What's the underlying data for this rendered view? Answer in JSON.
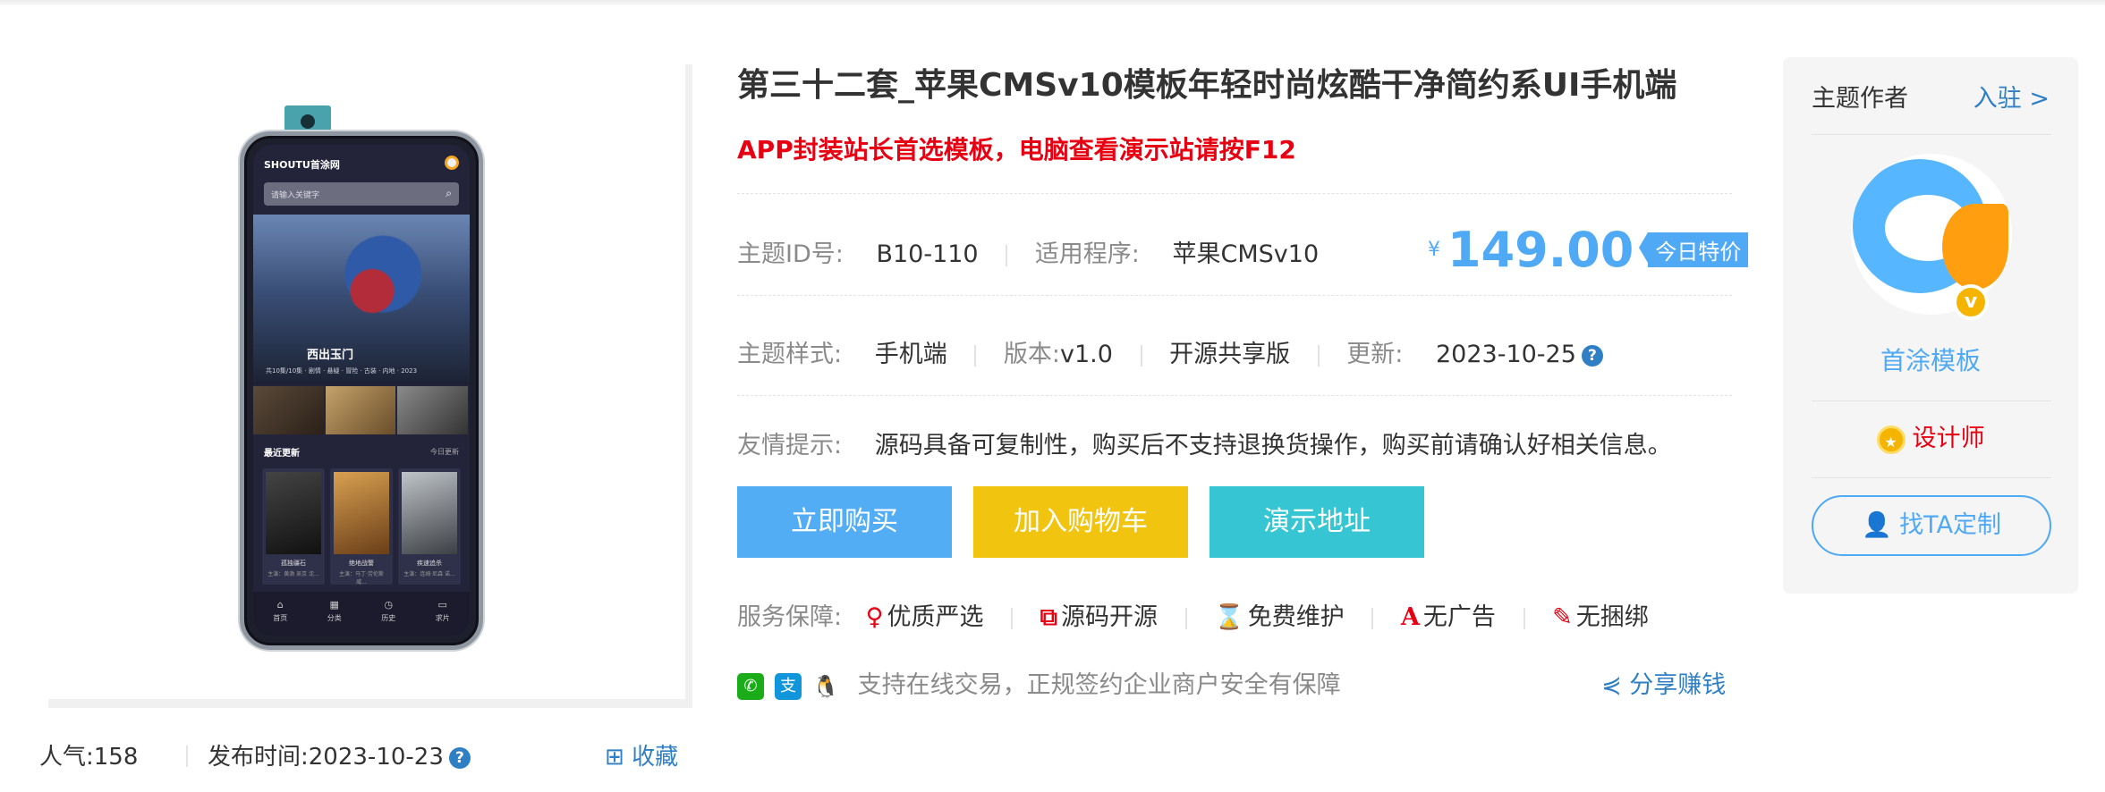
{
  "product": {
    "title": "第三十二套_苹果CMSv10模板年轻时尚炫酷干净简约系UI手机端",
    "subtitle": "APP封装站长首选模板，电脑查看演示站请按F12"
  },
  "info": {
    "id_label": "主题ID号:",
    "id_value": "B10-110",
    "program_label": "适用程序:",
    "program_value": "苹果CMSv10",
    "style_label": "主题样式:",
    "style_value": "手机端",
    "version_label": "版本:",
    "version_value": "v1.0",
    "license_value": "开源共享版",
    "update_label": "更新:",
    "update_value": "2023-10-25",
    "tip_label": "友情提示:",
    "tip_value": "源码具备可复制性，购买后不支持退换货操作，购买前请确认好相关信息。"
  },
  "price": {
    "currency": "¥",
    "amount": "149.00",
    "tag": "今日特价",
    "color": "#4fa9f5"
  },
  "buttons": {
    "buy": "立即购买",
    "cart": "加入购物车",
    "demo": "演示地址"
  },
  "service": {
    "label": "服务保障:",
    "items": [
      {
        "icon": "pin-icon",
        "glyph": "♥",
        "label": "优质严选"
      },
      {
        "icon": "copy-icon",
        "glyph": "⧉",
        "label": "源码开源"
      },
      {
        "icon": "hourglass-icon",
        "glyph": "⌛",
        "label": "免费维护"
      },
      {
        "icon": "no-ads-icon",
        "glyph": "A",
        "label": "无广告"
      },
      {
        "icon": "wrench-icon",
        "glyph": "✎",
        "label": "无捆绑"
      }
    ]
  },
  "payment": {
    "text": "支持在线交易，正规签约企业商户安全有保障",
    "share": "分享赚钱"
  },
  "meta": {
    "popularity_label": "人气:",
    "popularity_value": "158",
    "publish_label": "发布时间:",
    "publish_value": "2023-10-23",
    "favorite": "收藏"
  },
  "author": {
    "header": "主题作者",
    "join": "入驻 >",
    "name": "首涂模板",
    "role": "设计师",
    "custom_button": "找TA定制"
  },
  "preview_app": {
    "brand": "SHOUTU首涂网",
    "search_placeholder": "请输入关键字",
    "banner_title": "西出玉门",
    "banner_sub": "共10集/10集 · 剧情 · 悬疑 · 冒险 · 古装 · 内地 · 2023",
    "recent": "最近更新",
    "recent_more": "今日更新",
    "posters": [
      {
        "title": "孤独疆石",
        "sub": "主演：黄渤 吴京 沈..."
      },
      {
        "title": "绝地战警",
        "sub": "主演：马丁·劳伦斯 威..."
      },
      {
        "title": "疾速追杀",
        "sub": "主演：连姆·尼森 诺..."
      }
    ],
    "tabs": [
      "首页",
      "分类",
      "历史",
      "求片"
    ]
  }
}
